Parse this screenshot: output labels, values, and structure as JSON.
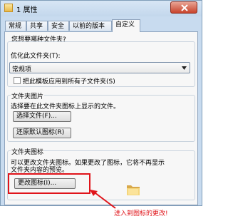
{
  "window": {
    "title": "1 属性",
    "close_icon": "close-icon"
  },
  "tabs": [
    {
      "label": "常规"
    },
    {
      "label": "共享"
    },
    {
      "label": "安全"
    },
    {
      "label": "以前的版本"
    },
    {
      "label": "自定义",
      "active": true
    }
  ],
  "customize": {
    "question": "您想要哪种文件夹?",
    "optimize_label": "优化此文件夹(T):",
    "optimize_value": "常规项",
    "apply_template_label": "把此模板应用到所有子文件夹(S)",
    "apply_template_checked": false
  },
  "folder_pictures": {
    "label": "文件夹图片",
    "description": "选择要在此文件夹图标上显示的文件。",
    "choose_file_button": "选择文件(F)...",
    "restore_default_button": "还原默认图标(R)"
  },
  "folder_icons": {
    "label": "文件夹图标",
    "line1": "可以更改文件夹图标。如果更改了图标，它将不再显示",
    "line2": "文件夹内容的预览。",
    "change_icon_button": "更改图标(I)..."
  },
  "annotation": {
    "text": "进入到图标的更改!",
    "color": "#e0141a"
  }
}
